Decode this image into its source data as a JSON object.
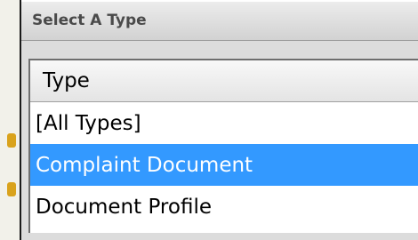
{
  "dialog": {
    "title": "Select A Type"
  },
  "type_list": {
    "column_header": "Type",
    "items": [
      {
        "label": "[All Types]",
        "selected": false
      },
      {
        "label": "Complaint Document",
        "selected": true
      },
      {
        "label": "Document Profile",
        "selected": false
      }
    ]
  },
  "colors": {
    "selection": "#3399ff",
    "background": "#d4d0c8"
  }
}
